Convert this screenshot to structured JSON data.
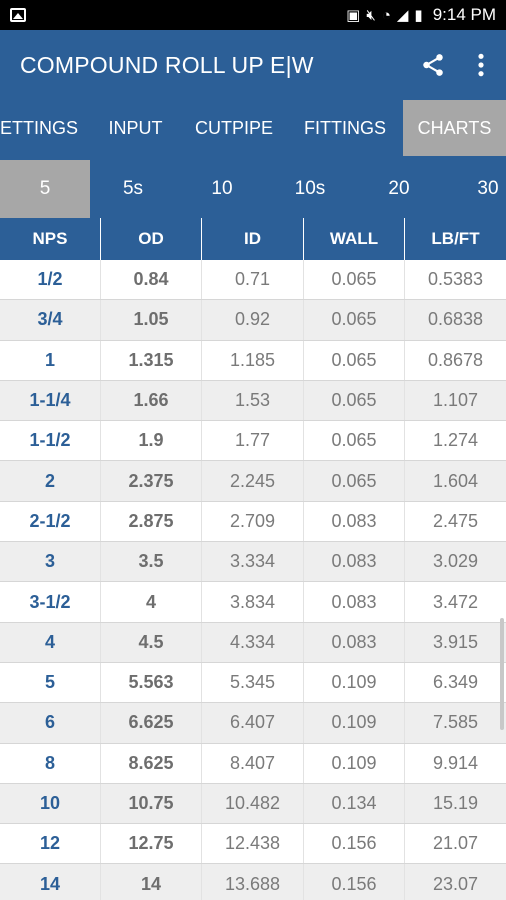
{
  "status": {
    "time": "9:14 PM"
  },
  "appbar": {
    "title": "COMPOUND ROLL UP E|W"
  },
  "tabs": [
    {
      "label": "ETTINGS",
      "active": false
    },
    {
      "label": "INPUT",
      "active": false
    },
    {
      "label": "CUTPIPE",
      "active": false
    },
    {
      "label": "FITTINGS",
      "active": false
    },
    {
      "label": "CHARTS",
      "active": true
    }
  ],
  "schedules": [
    {
      "label": "5",
      "active": true
    },
    {
      "label": "5s",
      "active": false
    },
    {
      "label": "10",
      "active": false
    },
    {
      "label": "10s",
      "active": false
    },
    {
      "label": "20",
      "active": false
    },
    {
      "label": "30",
      "active": false
    }
  ],
  "table": {
    "headers": [
      "NPS",
      "OD",
      "ID",
      "WALL",
      "LB/FT"
    ],
    "rows": [
      [
        "1/2",
        "0.84",
        "0.71",
        "0.065",
        "0.5383"
      ],
      [
        "3/4",
        "1.05",
        "0.92",
        "0.065",
        "0.6838"
      ],
      [
        "1",
        "1.315",
        "1.185",
        "0.065",
        "0.8678"
      ],
      [
        "1-1/4",
        "1.66",
        "1.53",
        "0.065",
        "1.107"
      ],
      [
        "1-1/2",
        "1.9",
        "1.77",
        "0.065",
        "1.274"
      ],
      [
        "2",
        "2.375",
        "2.245",
        "0.065",
        "1.604"
      ],
      [
        "2-1/2",
        "2.875",
        "2.709",
        "0.083",
        "2.475"
      ],
      [
        "3",
        "3.5",
        "3.334",
        "0.083",
        "3.029"
      ],
      [
        "3-1/2",
        "4",
        "3.834",
        "0.083",
        "3.472"
      ],
      [
        "4",
        "4.5",
        "4.334",
        "0.083",
        "3.915"
      ],
      [
        "5",
        "5.563",
        "5.345",
        "0.109",
        "6.349"
      ],
      [
        "6",
        "6.625",
        "6.407",
        "0.109",
        "7.585"
      ],
      [
        "8",
        "8.625",
        "8.407",
        "0.109",
        "9.914"
      ],
      [
        "10",
        "10.75",
        "10.482",
        "0.134",
        "15.19"
      ],
      [
        "12",
        "12.75",
        "12.438",
        "0.156",
        "21.07"
      ],
      [
        "14",
        "14",
        "13.688",
        "0.156",
        "23.07"
      ]
    ]
  },
  "colors": {
    "primary": "#2c5f97",
    "active_tab": "#a7a7a7",
    "nps_text": "#2c5f97"
  },
  "icons": [
    "gallery-icon",
    "nfc-icon",
    "mute-icon",
    "wifi-icon",
    "signal-icon",
    "battery-icon",
    "share-icon",
    "more-vert-icon"
  ]
}
